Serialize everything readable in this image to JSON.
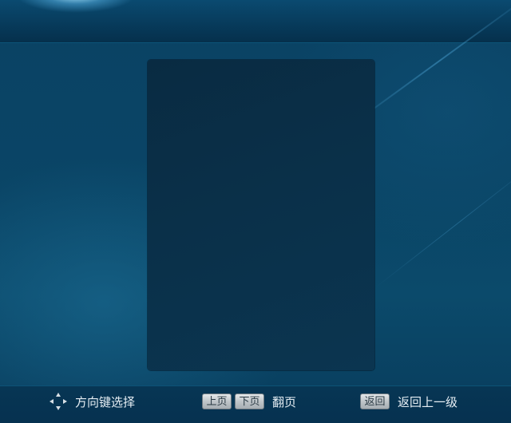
{
  "footer": {
    "navigate_label": "方向键选择",
    "page_up_key": "上页",
    "page_down_key": "下页",
    "page_turn_label": "翻页",
    "back_key": "返回",
    "back_label": "返回上一级"
  },
  "icons": {
    "dpad": "dpad-arrows-icon"
  }
}
